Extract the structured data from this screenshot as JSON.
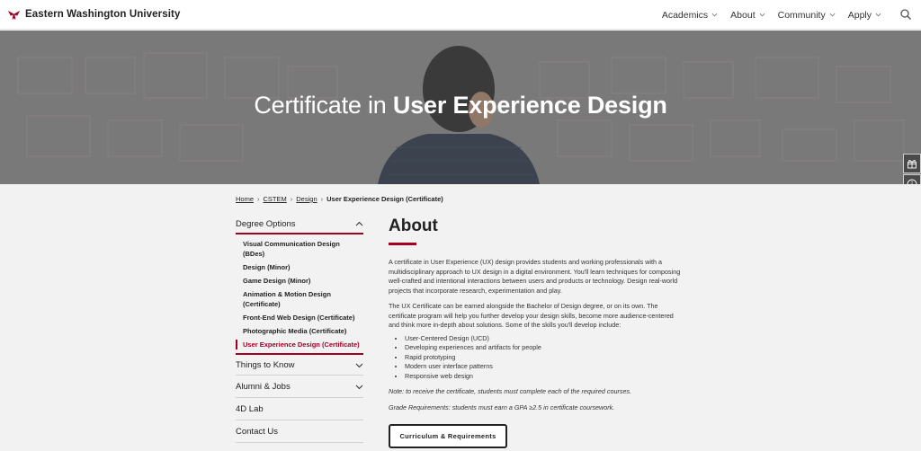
{
  "header": {
    "brand_name": "Eastern Washington University",
    "nav": [
      "Academics",
      "About",
      "Community",
      "Apply"
    ],
    "search_icon": "search-icon",
    "brand_color": "#a10022"
  },
  "hero": {
    "title_light": "Certificate in ",
    "title_bold": "User Experience Design",
    "tools": [
      "gift-icon",
      "info-icon"
    ]
  },
  "breadcrumb": {
    "home": "Home",
    "cstem": "CSTEM",
    "design": "Design",
    "sep": "›",
    "current": "User Experience Design (Certificate)"
  },
  "sidebar": {
    "degree_options": "Degree Options",
    "items": [
      "Visual Communication Design (BDes)",
      "Design (Minor)",
      "Game Design (Minor)",
      "Animation & Motion Design (Certificate)",
      "Front-End Web Design (Certificate)",
      "Photographic Media (Certificate)",
      "User Experience Design (Certificate)"
    ],
    "things_to_know": "Things to Know",
    "alumni_jobs": "Alumni & Jobs",
    "lab": "4D Lab",
    "contact": "Contact Us"
  },
  "main": {
    "heading": "About",
    "para1": "A certificate in User Experience (UX) design provides students and working professionals with a multidisciplinary approach to UX design in a digital environment. You'll learn techniques for composing well-crafted and intentional interactions between users and products or technology. Design real-world projects that incorporate research, experimentation and play.",
    "para2": "The UX Certificate can be earned alongside the Bachelor of Design degree, or on its own. The certificate program will help you further develop your design skills, become more audience-centered and think more in-depth about solutions. Some of the skills you'll develop include:",
    "skills": [
      "User-Centered Design (UCD)",
      "Developing experiences and artifacts for people",
      "Rapid prototyping",
      "Modern user interface patterns",
      "Responsive web design"
    ],
    "note": "Note: to receive the certificate, students must complete each of the required courses.",
    "grade": "Grade Requirements: students must earn a GPA ≥2.5 in certificate coursework.",
    "cta": "Curriculum & Requirements"
  }
}
